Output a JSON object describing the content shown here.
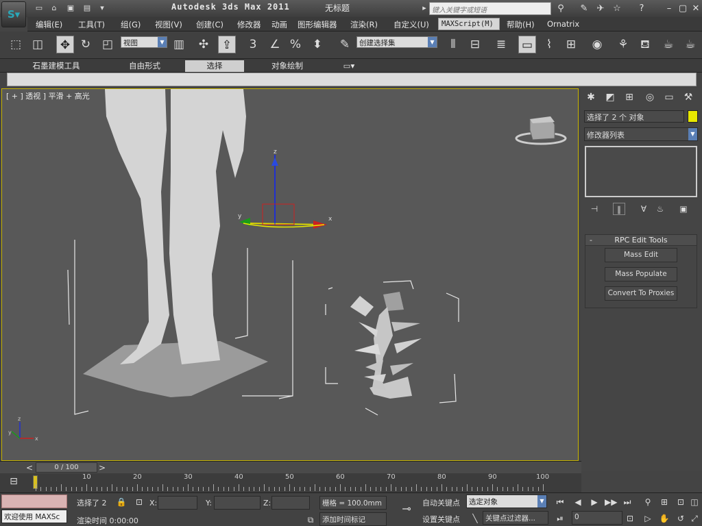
{
  "title_bar": {
    "app_title": "Autodesk 3ds Max  2011",
    "doc_title": "无标题",
    "search_placeholder": "键入关键字或短语"
  },
  "menu": {
    "items": [
      "编辑(E)",
      "工具(T)",
      "组(G)",
      "视图(V)",
      "创建(C)",
      "修改器",
      "动画",
      "图形编辑器",
      "渲染(R)",
      "自定义(U)",
      "MAXScript(M)",
      "帮助(H)",
      "Ornatrix"
    ]
  },
  "toolbar": {
    "view_dropdown": "视图",
    "selection_set_dropdown": "创建选择集"
  },
  "ribbon": {
    "tabs": [
      "石墨建模工具",
      "自由形式",
      "选择",
      "对象绘制"
    ],
    "active": "选择"
  },
  "viewport": {
    "label": "[ + ] 透视 ] 平滑 + 高光",
    "gizmo_x": "x",
    "gizmo_y": "y",
    "gizmo_z": "z"
  },
  "command_panel": {
    "selection_text": "选择了 2 个 对象",
    "swatch_color": "#e8e800",
    "modifier_list": "修改器列表",
    "rollout_title": "RPC Edit Tools",
    "rollout_buttons": [
      "Mass Edit",
      "Mass Populate",
      "Convert To Proxies"
    ]
  },
  "timeline": {
    "slider_text": "0 / 100",
    "ticks": [
      "10",
      "20",
      "30",
      "40",
      "50",
      "60",
      "70",
      "80",
      "90",
      "100"
    ]
  },
  "status": {
    "welcome": "欢迎使用 MAXSc",
    "selected": "选择了 2",
    "x_label": "X:",
    "y_label": "Y:",
    "z_label": "Z:",
    "grid": "栅格 = 100.0mm",
    "render_time": "渲染时间  0:00:00",
    "add_time_tag": "添加时间标记",
    "auto_key": "自动关键点",
    "set_key": "设置关键点",
    "selected_object": "选定对象",
    "key_filters": "关键点过滤器...",
    "frame": "0"
  }
}
